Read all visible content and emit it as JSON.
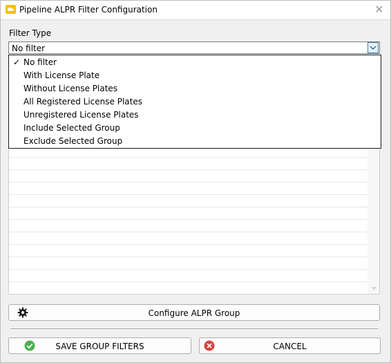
{
  "window": {
    "title": "Pipeline ALPR Filter Configuration",
    "close_icon": "close-icon",
    "app_icon": "camera-app-icon",
    "accent_color": "#f3c300"
  },
  "filter": {
    "label": "Filter Type",
    "selected_value": "No filter",
    "options": [
      {
        "label": "No filter",
        "checked": "✓"
      },
      {
        "label": "With License Plate",
        "checked": ""
      },
      {
        "label": "Without License Plates",
        "checked": ""
      },
      {
        "label": "All Registered License Plates",
        "checked": ""
      },
      {
        "label": "Unregistered License Plates",
        "checked": ""
      },
      {
        "label": "Include Selected Group",
        "checked": ""
      },
      {
        "label": "Exclude Selected Group",
        "checked": ""
      }
    ]
  },
  "buttons": {
    "configure_label": "Configure ALPR Group",
    "save_label": "SAVE GROUP FILTERS",
    "cancel_label": "CANCEL",
    "save_icon_color": "#4caf50",
    "cancel_icon_color": "#d64541"
  }
}
